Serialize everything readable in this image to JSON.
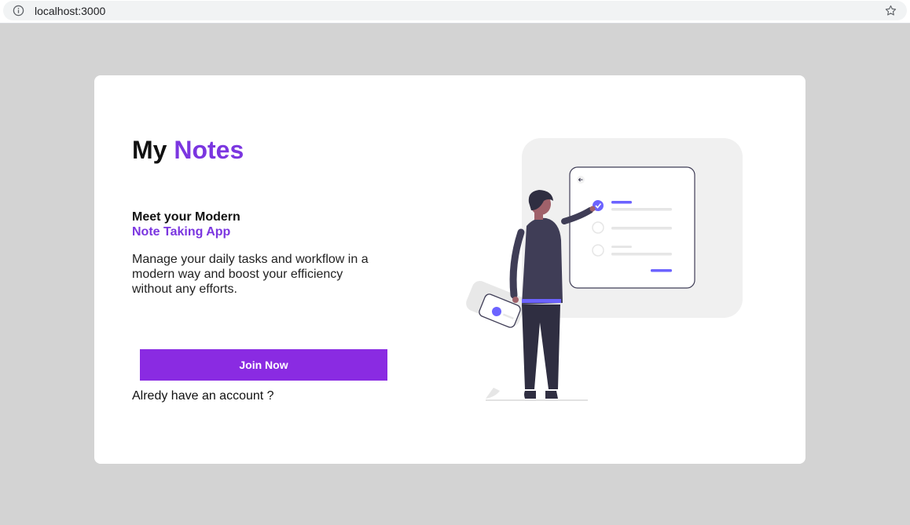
{
  "browser": {
    "url": "localhost:3000",
    "icons": [
      "info-icon",
      "star-icon"
    ]
  },
  "hero": {
    "title_part1": "My",
    "title_part2": "Notes",
    "tagline_line1": "Meet your Modern",
    "tagline_line2": "Note Taking App",
    "description": "Manage your daily tasks and workflow in a modern way and boost your efficiency without any efforts.",
    "join_button_label": "Join Now",
    "login_link": "Alredy have an account ?"
  },
  "colors": {
    "accent": "#7b36e0",
    "button": "#8a2be2",
    "page_background": "#d3d3d3",
    "card_background": "#ffffff",
    "illustration_accent": "#6c63ff",
    "figure_dark": "#3f3d56"
  }
}
